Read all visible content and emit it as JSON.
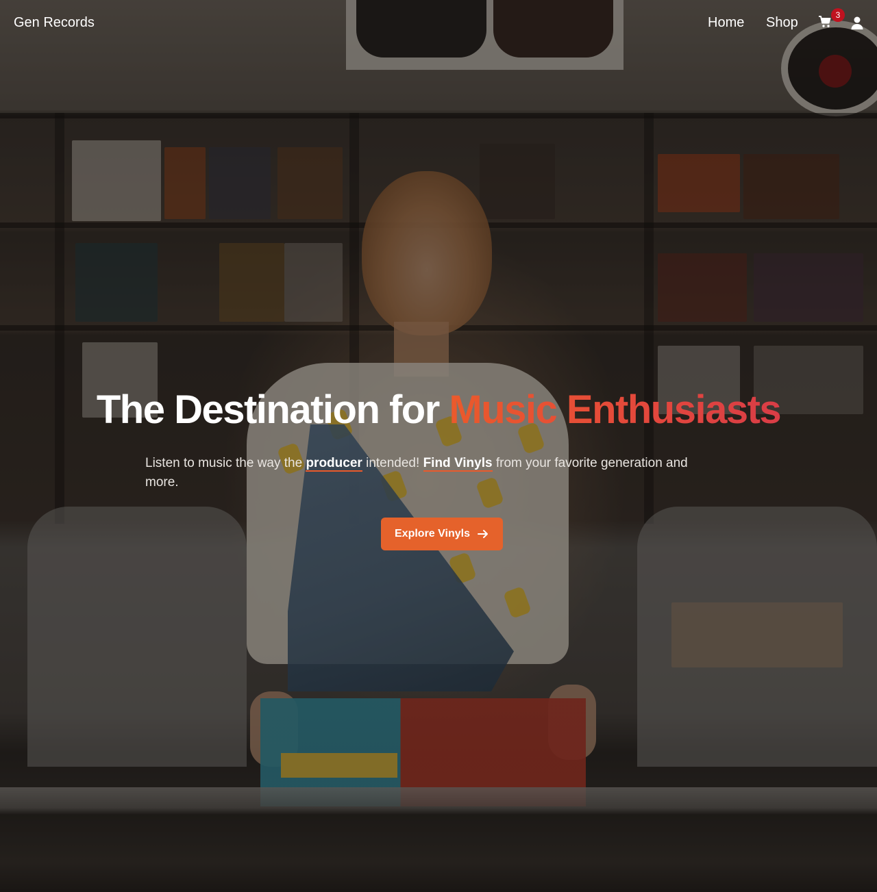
{
  "nav": {
    "brand": "Gen Records",
    "links": [
      {
        "label": "Home"
      },
      {
        "label": "Shop"
      }
    ],
    "cart_count": "3",
    "cart_icon": "shopping-cart-icon",
    "user_icon": "user-icon"
  },
  "hero": {
    "headline_part1": "The Destination for ",
    "headline_accent": "Music Enthusiasts",
    "lead_part1": "Listen to music the way the ",
    "lead_link1": "producer",
    "lead_part2": " intended! ",
    "lead_link2": "Find Vinyls",
    "lead_part3": " from your favorite generation and more.",
    "cta_label": "Explore Vinyls",
    "cta_icon": "arrow-right-icon"
  },
  "colors": {
    "accent_orange": "#e5622b",
    "accent_red": "#d93d46",
    "badge_red": "#c0121f"
  }
}
